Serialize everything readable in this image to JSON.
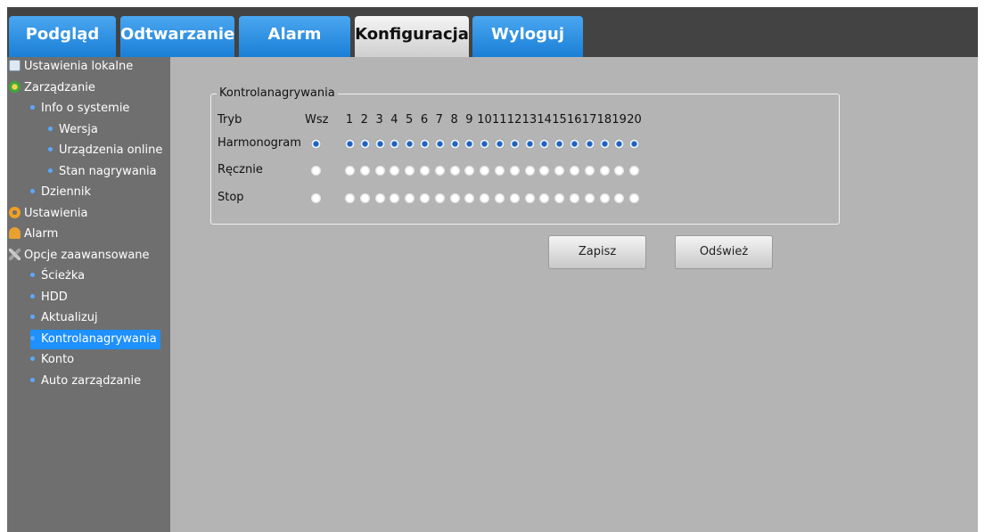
{
  "tabs": [
    {
      "label": "Podgląd",
      "active": false
    },
    {
      "label": "Odtwarzanie",
      "active": false
    },
    {
      "label": "Alarm",
      "active": false
    },
    {
      "label": "Konfiguracja",
      "active": true
    },
    {
      "label": "Wyloguj",
      "active": false
    }
  ],
  "sidebar": {
    "items": [
      {
        "label": "Ustawienia lokalne",
        "level": 0,
        "icon": "monitor-icon"
      },
      {
        "label": "Zarządzanie",
        "level": 0,
        "icon": "info-icon"
      },
      {
        "label": "Info o systemie",
        "level": 1
      },
      {
        "label": "Wersja",
        "level": 2
      },
      {
        "label": "Urządzenia online",
        "level": 2
      },
      {
        "label": "Stan nagrywania",
        "level": 2
      },
      {
        "label": "Dziennik",
        "level": 1
      },
      {
        "label": "Ustawienia",
        "level": 0,
        "icon": "gear-icon"
      },
      {
        "label": "Alarm",
        "level": 0,
        "icon": "bell-icon"
      },
      {
        "label": "Opcje zaawansowane",
        "level": 0,
        "icon": "tools-icon"
      },
      {
        "label": "Ścieżka",
        "level": 1
      },
      {
        "label": "HDD",
        "level": 1
      },
      {
        "label": "Aktualizuj",
        "level": 1
      },
      {
        "label": "Kontrolanagrywania",
        "level": 1,
        "selected": true
      },
      {
        "label": "Konto",
        "level": 1
      },
      {
        "label": "Auto zarządzanie",
        "level": 1
      }
    ]
  },
  "record_control": {
    "legend": "Kontrolanagrywania",
    "mode_header": "Tryb",
    "all_header": "Wsz",
    "channels": [
      "1",
      "2",
      "3",
      "4",
      "5",
      "6",
      "7",
      "8",
      "9",
      "10",
      "11",
      "12",
      "13",
      "14",
      "15",
      "16",
      "17",
      "18",
      "19",
      "20"
    ],
    "rows": [
      {
        "label": "Harmonogram",
        "all_selected": true,
        "selected": [
          true,
          true,
          true,
          true,
          true,
          true,
          true,
          true,
          true,
          true,
          true,
          true,
          true,
          true,
          true,
          true,
          true,
          true,
          true,
          true
        ]
      },
      {
        "label": "Ręcznie",
        "all_selected": false,
        "selected": [
          false,
          false,
          false,
          false,
          false,
          false,
          false,
          false,
          false,
          false,
          false,
          false,
          false,
          false,
          false,
          false,
          false,
          false,
          false,
          false
        ]
      },
      {
        "label": "Stop",
        "all_selected": false,
        "selected": [
          false,
          false,
          false,
          false,
          false,
          false,
          false,
          false,
          false,
          false,
          false,
          false,
          false,
          false,
          false,
          false,
          false,
          false,
          false,
          false
        ]
      }
    ]
  },
  "buttons": {
    "save": "Zapisz",
    "refresh": "Odśwież"
  },
  "colors": {
    "tab_active": "#e8e8e8",
    "tab": "#2a8ae0",
    "topbar": "#434343",
    "sidebar": "#6f6f6f",
    "content": "#b4b4b4",
    "selection": "#1e90ff"
  }
}
